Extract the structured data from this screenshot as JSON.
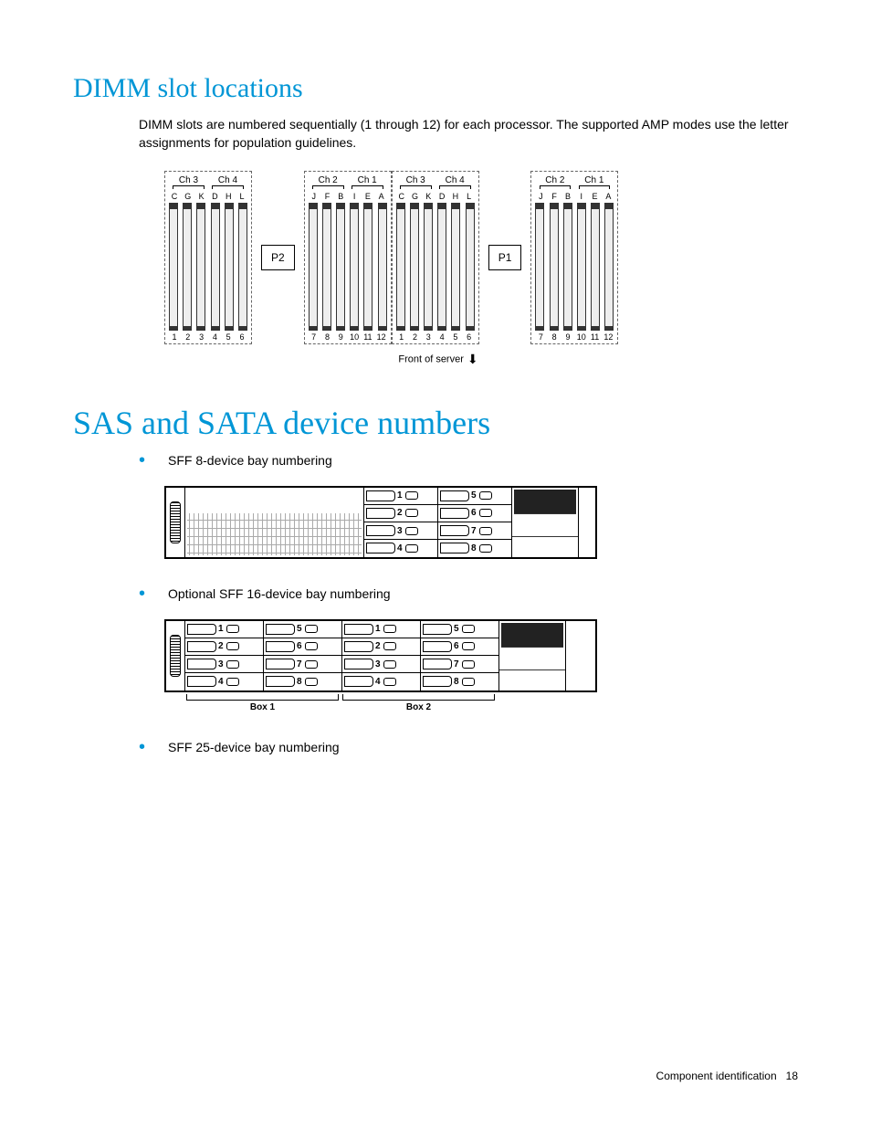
{
  "headings": {
    "dimm": "DIMM slot locations",
    "sas": "SAS and SATA device numbers"
  },
  "paragraphs": {
    "dimm_intro": "DIMM slots are numbered sequentially (1 through 12) for each processor. The supported AMP modes use the letter assignments for population guidelines."
  },
  "bullets": {
    "sff8": "SFF 8-device bay numbering",
    "sff16": "Optional SFF 16-device bay numbering",
    "sff25": "SFF 25-device bay numbering"
  },
  "dimm_diagram": {
    "processors": {
      "p1": "P1",
      "p2": "P2"
    },
    "channel_left": [
      "Ch 3",
      "Ch 4"
    ],
    "channel_right": [
      "Ch 2",
      "Ch 1"
    ],
    "letters_left": [
      "C",
      "G",
      "K",
      "D",
      "H",
      "L"
    ],
    "letters_right": [
      "J",
      "F",
      "B",
      "I",
      "E",
      "A"
    ],
    "nums_left": [
      "1",
      "2",
      "3",
      "4",
      "5",
      "6"
    ],
    "nums_right": [
      "7",
      "8",
      "9",
      "10",
      "11",
      "12"
    ],
    "front_label": "Front of server"
  },
  "bay8": {
    "col1": [
      "1",
      "2",
      "3",
      "4"
    ],
    "col2": [
      "5",
      "6",
      "7",
      "8"
    ]
  },
  "bay16": {
    "box1_col1": [
      "1",
      "2",
      "3",
      "4"
    ],
    "box1_col2": [
      "5",
      "6",
      "7",
      "8"
    ],
    "box2_col1": [
      "1",
      "2",
      "3",
      "4"
    ],
    "box2_col2": [
      "5",
      "6",
      "7",
      "8"
    ],
    "box1_label": "Box 1",
    "box2_label": "Box 2"
  },
  "footer": {
    "section": "Component identification",
    "page": "18"
  }
}
